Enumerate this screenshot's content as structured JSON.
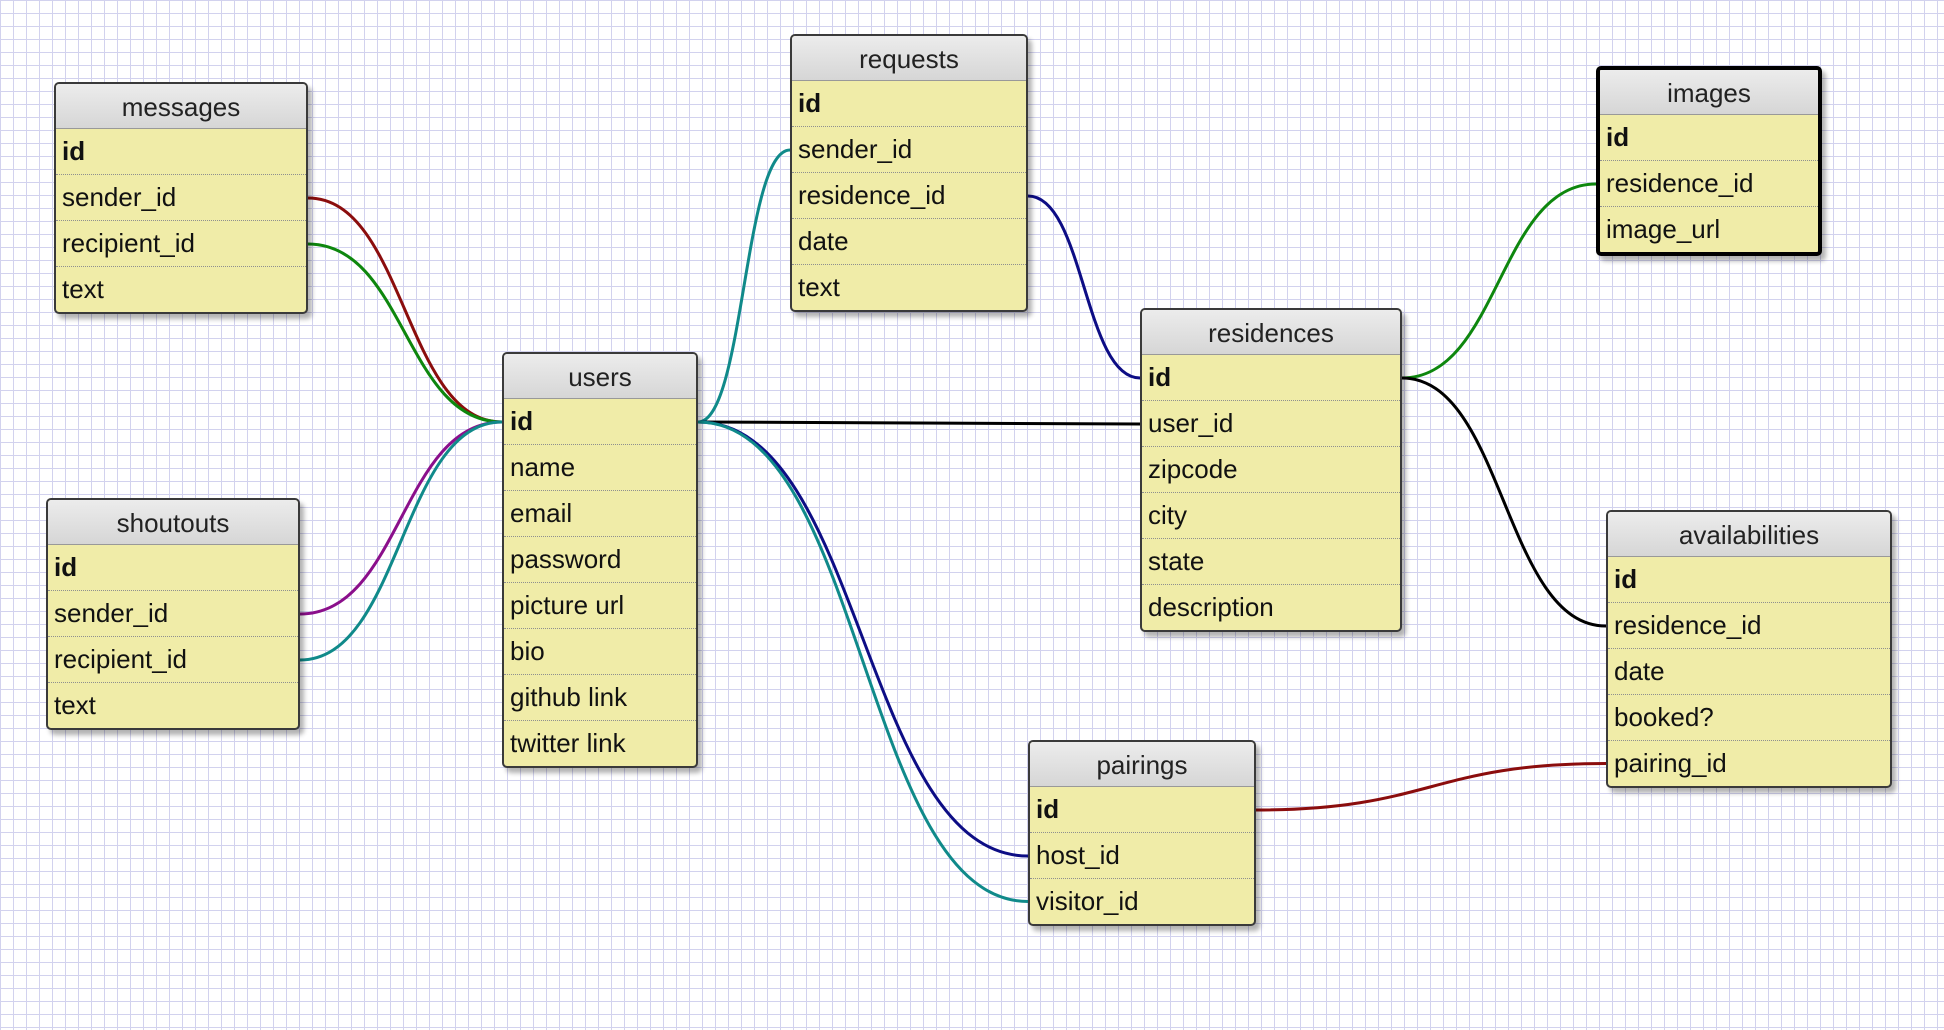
{
  "diagram": {
    "tables": [
      {
        "id": "messages",
        "title": "messages",
        "fields": [
          {
            "name": "id",
            "pk": true
          },
          {
            "name": "sender_id"
          },
          {
            "name": "recipient_id"
          },
          {
            "name": "text"
          }
        ]
      },
      {
        "id": "shoutouts",
        "title": "shoutouts",
        "fields": [
          {
            "name": "id",
            "pk": true
          },
          {
            "name": "sender_id"
          },
          {
            "name": "recipient_id"
          },
          {
            "name": "text"
          }
        ]
      },
      {
        "id": "users",
        "title": "users",
        "fields": [
          {
            "name": "id",
            "pk": true
          },
          {
            "name": "name"
          },
          {
            "name": "email"
          },
          {
            "name": "password"
          },
          {
            "name": "picture url"
          },
          {
            "name": "bio"
          },
          {
            "name": "github link"
          },
          {
            "name": "twitter link"
          }
        ]
      },
      {
        "id": "requests",
        "title": "requests",
        "fields": [
          {
            "name": "id",
            "pk": true
          },
          {
            "name": "sender_id"
          },
          {
            "name": "residence_id"
          },
          {
            "name": "date"
          },
          {
            "name": "text"
          }
        ]
      },
      {
        "id": "residences",
        "title": "residences",
        "fields": [
          {
            "name": "id",
            "pk": true
          },
          {
            "name": "user_id"
          },
          {
            "name": "zipcode"
          },
          {
            "name": "city"
          },
          {
            "name": "state"
          },
          {
            "name": "description"
          }
        ]
      },
      {
        "id": "images",
        "title": "images",
        "selected": true,
        "fields": [
          {
            "name": "id",
            "pk": true
          },
          {
            "name": "residence_id"
          },
          {
            "name": "image_url"
          }
        ]
      },
      {
        "id": "availabilities",
        "title": "availabilities",
        "fields": [
          {
            "name": "id",
            "pk": true
          },
          {
            "name": "residence_id"
          },
          {
            "name": "date"
          },
          {
            "name": "booked?"
          },
          {
            "name": "pairing_id"
          }
        ]
      },
      {
        "id": "pairings",
        "title": "pairings",
        "fields": [
          {
            "name": "id",
            "pk": true
          },
          {
            "name": "host_id"
          },
          {
            "name": "visitor_id"
          }
        ]
      }
    ],
    "relations": [
      {
        "from": [
          "messages",
          "sender_id"
        ],
        "to": [
          "users",
          "id"
        ],
        "color": "#8b0d0d"
      },
      {
        "from": [
          "messages",
          "recipient_id"
        ],
        "to": [
          "users",
          "id"
        ],
        "color": "#0e870e"
      },
      {
        "from": [
          "shoutouts",
          "sender_id"
        ],
        "to": [
          "users",
          "id"
        ],
        "color": "#8b0f8b"
      },
      {
        "from": [
          "shoutouts",
          "recipient_id"
        ],
        "to": [
          "users",
          "id"
        ],
        "color": "#108a8a"
      },
      {
        "from": [
          "requests",
          "sender_id"
        ],
        "to": [
          "users",
          "id"
        ],
        "color": "#108a8a"
      },
      {
        "from": [
          "requests",
          "residence_id"
        ],
        "to": [
          "residences",
          "id"
        ],
        "color": "#0d0d85"
      },
      {
        "from": [
          "residences",
          "user_id"
        ],
        "to": [
          "users",
          "id"
        ],
        "color": "#000000"
      },
      {
        "from": [
          "pairings",
          "host_id"
        ],
        "to": [
          "users",
          "id"
        ],
        "color": "#0d0d85"
      },
      {
        "from": [
          "pairings",
          "visitor_id"
        ],
        "to": [
          "users",
          "id"
        ],
        "color": "#108a8a"
      },
      {
        "from": [
          "images",
          "residence_id"
        ],
        "to": [
          "residences",
          "id"
        ],
        "color": "#0e870e"
      },
      {
        "from": [
          "availabilities",
          "residence_id"
        ],
        "to": [
          "residences",
          "id"
        ],
        "color": "#000000"
      },
      {
        "from": [
          "availabilities",
          "pairing_id"
        ],
        "to": [
          "pairings",
          "id"
        ],
        "color": "#8b0d0d"
      }
    ]
  }
}
